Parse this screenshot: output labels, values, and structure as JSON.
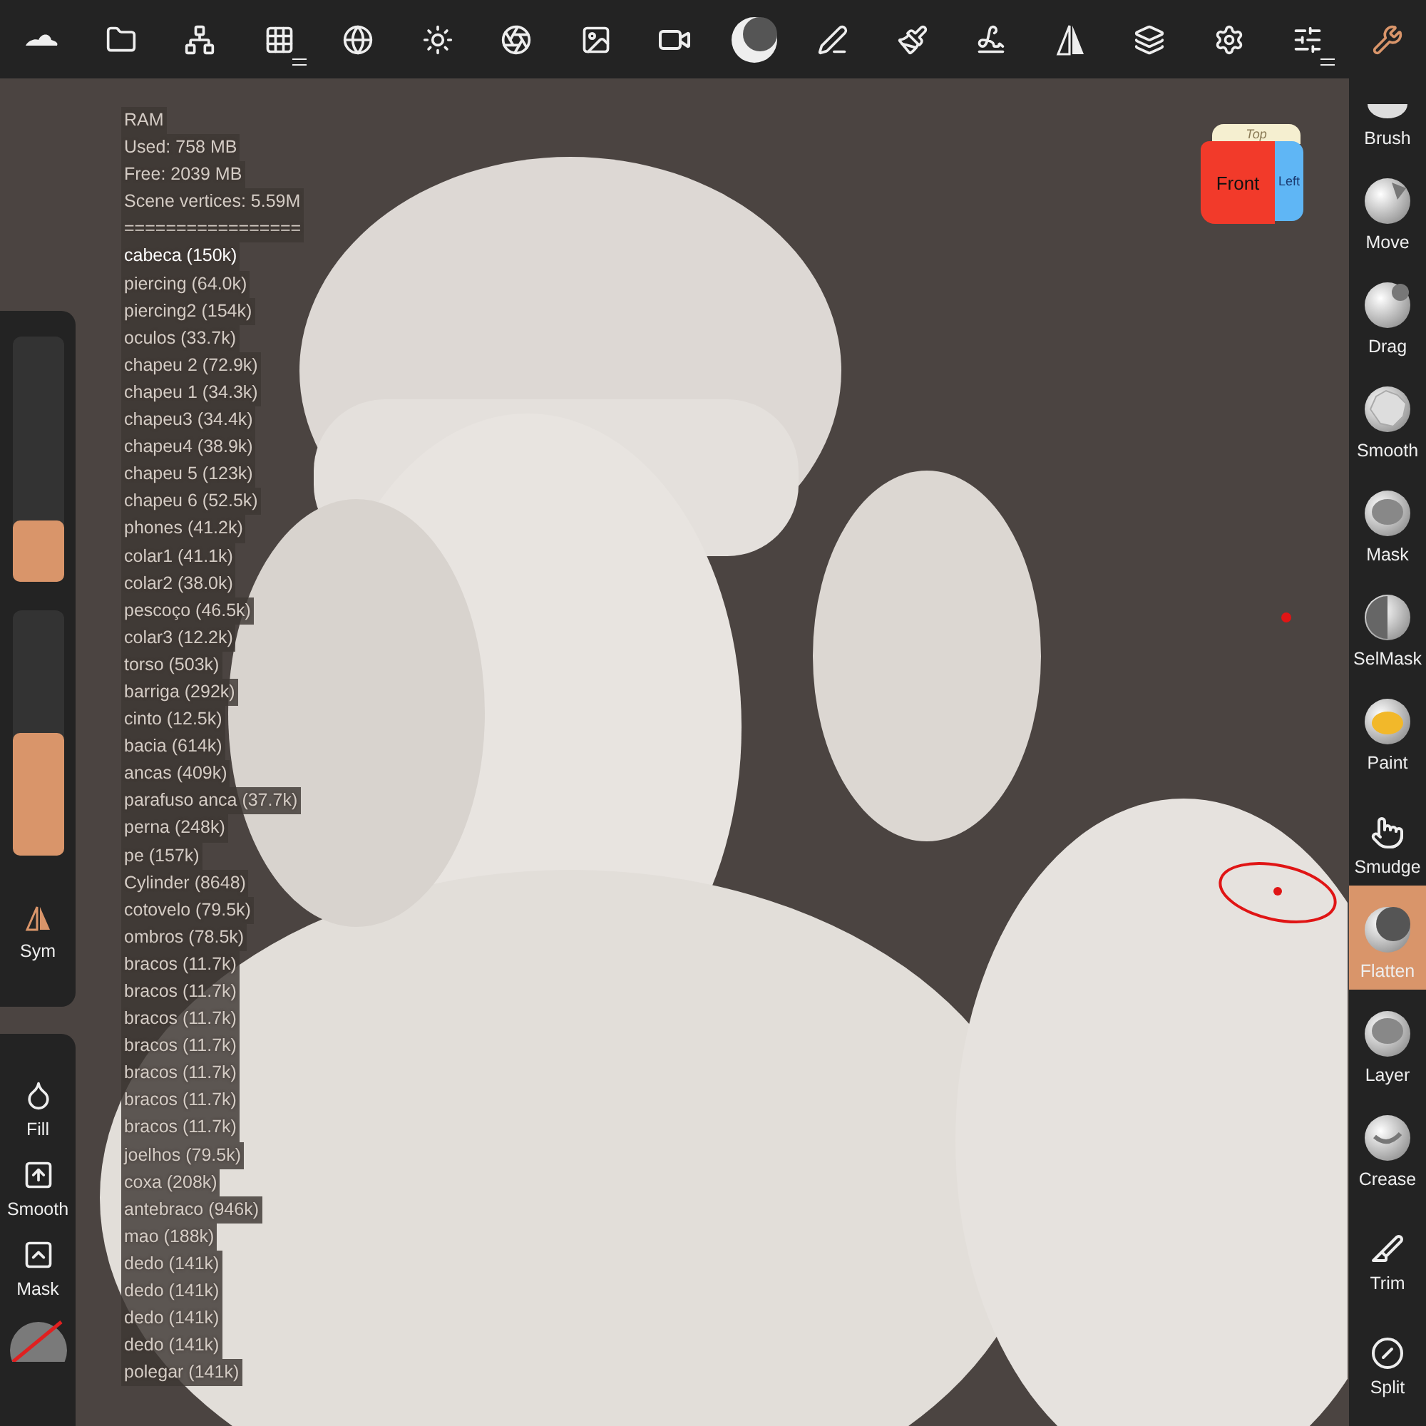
{
  "toolbar": [
    {
      "selected": false
    },
    {
      "selected": false
    },
    {
      "selected": false
    },
    {
      "selected": false
    },
    {
      "selected": false
    },
    {
      "selected": false
    },
    {
      "selected": false
    },
    {
      "selected": false
    },
    {
      "selected": false
    },
    {
      "selected": false
    },
    {
      "selected": false
    },
    {
      "selected": false
    },
    {
      "selected": false
    },
    {
      "selected": false
    },
    {
      "selected": false
    },
    {
      "selected": false
    },
    {
      "selected": false
    },
    {
      "selected": true
    }
  ],
  "stats": [
    "RAM",
    "Used: 758 MB",
    "Free: 2039 MB",
    "Scene vertices: 5.59M",
    "================="
  ],
  "objects": [
    {
      "label": "cabeca (150k)",
      "selected": true
    },
    {
      "label": "piercing (64.0k)",
      "selected": false
    },
    {
      "label": "piercing2 (154k)",
      "selected": false
    },
    {
      "label": "oculos (33.7k)",
      "selected": false
    },
    {
      "label": "chapeu 2 (72.9k)",
      "selected": false
    },
    {
      "label": "chapeu 1 (34.3k)",
      "selected": false
    },
    {
      "label": "chapeu3 (34.4k)",
      "selected": false
    },
    {
      "label": "chapeu4 (38.9k)",
      "selected": false
    },
    {
      "label": "chapeu 5 (123k)",
      "selected": false
    },
    {
      "label": "chapeu 6 (52.5k)",
      "selected": false
    },
    {
      "label": "phones (41.2k)",
      "selected": false
    },
    {
      "label": "colar1 (41.1k)",
      "selected": false
    },
    {
      "label": "colar2 (38.0k)",
      "selected": false
    },
    {
      "label": "pescoço  (46.5k)",
      "selected": false
    },
    {
      "label": "colar3 (12.2k)",
      "selected": false
    },
    {
      "label": "torso (503k)",
      "selected": false
    },
    {
      "label": "barriga (292k)",
      "selected": false
    },
    {
      "label": "cinto (12.5k)",
      "selected": false
    },
    {
      "label": "bacia (614k)",
      "selected": false
    },
    {
      "label": "ancas (409k)",
      "selected": false
    },
    {
      "label": "parafuso anca (37.7k)",
      "selected": false
    },
    {
      "label": "perna (248k)",
      "selected": false
    },
    {
      "label": "pe (157k)",
      "selected": false
    },
    {
      "label": "Cylinder (8648)",
      "selected": false
    },
    {
      "label": "cotovelo (79.5k)",
      "selected": false
    },
    {
      "label": "ombros (78.5k)",
      "selected": false
    },
    {
      "label": "bracos (11.7k)",
      "selected": false
    },
    {
      "label": "bracos (11.7k)",
      "selected": false
    },
    {
      "label": "bracos (11.7k)",
      "selected": false
    },
    {
      "label": "bracos (11.7k)",
      "selected": false
    },
    {
      "label": "bracos (11.7k)",
      "selected": false
    },
    {
      "label": "bracos (11.7k)",
      "selected": false
    },
    {
      "label": "bracos (11.7k)",
      "selected": false
    },
    {
      "label": "joelhos (79.5k)",
      "selected": false
    },
    {
      "label": "coxa (208k)",
      "selected": false
    },
    {
      "label": "antebraco (946k)",
      "selected": false
    },
    {
      "label": "mao (188k)",
      "selected": false
    },
    {
      "label": "dedo (141k)",
      "selected": false
    },
    {
      "label": "dedo (141k)",
      "selected": false
    },
    {
      "label": "dedo (141k)",
      "selected": false
    },
    {
      "label": "dedo (141k)",
      "selected": false
    },
    {
      "label": "polegar (141k)",
      "selected": false
    }
  ],
  "view_cube": {
    "top": "Top",
    "front": "Front",
    "left": "Left"
  },
  "sliders": [
    {
      "level": 0.25
    },
    {
      "level": 0.5
    }
  ],
  "symmetry": {
    "label": "Sym",
    "on": true
  },
  "actions": [
    {
      "label": "Fill"
    },
    {
      "label": "Smooth"
    },
    {
      "label": "Mask"
    }
  ],
  "tools": [
    {
      "label": "Brush",
      "selected": false
    },
    {
      "label": "Move",
      "selected": false
    },
    {
      "label": "Drag",
      "selected": false
    },
    {
      "label": "Smooth",
      "selected": false
    },
    {
      "label": "Mask",
      "selected": false
    },
    {
      "label": "SelMask",
      "selected": false
    },
    {
      "label": "Paint",
      "selected": false
    },
    {
      "label": "Smudge",
      "selected": false
    },
    {
      "label": "Flatten",
      "selected": true
    },
    {
      "label": "Layer",
      "selected": false
    },
    {
      "label": "Crease",
      "selected": false
    },
    {
      "label": "Trim",
      "selected": false
    },
    {
      "label": "Split",
      "selected": false
    }
  ]
}
